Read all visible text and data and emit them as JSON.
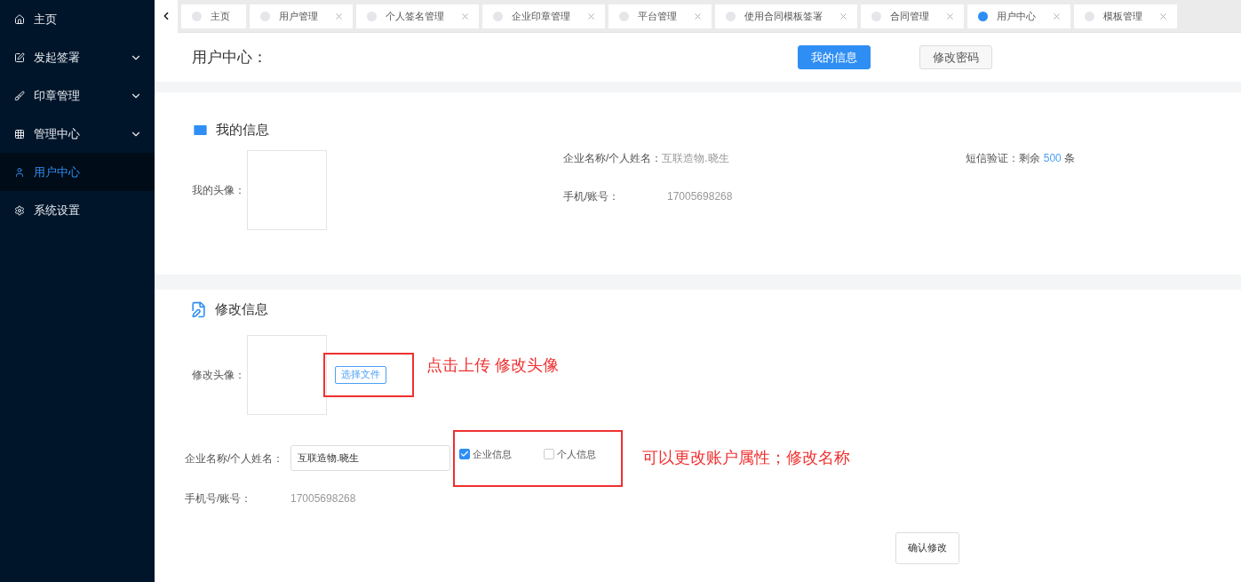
{
  "sidebar": {
    "items": [
      {
        "label": "主页",
        "expandable": false,
        "selected": false
      },
      {
        "label": "发起签署",
        "expandable": true,
        "selected": false
      },
      {
        "label": "印章管理",
        "expandable": true,
        "selected": false
      },
      {
        "label": "管理中心",
        "expandable": true,
        "selected": false
      },
      {
        "label": "用户中心",
        "expandable": false,
        "selected": true
      },
      {
        "label": "系统设置",
        "expandable": false,
        "selected": false
      }
    ]
  },
  "tabs": [
    {
      "label": "主页",
      "closable": false,
      "selected": false
    },
    {
      "label": "用户管理",
      "closable": true,
      "selected": false
    },
    {
      "label": "个人签名管理",
      "closable": true,
      "selected": false
    },
    {
      "label": "企业印章管理",
      "closable": true,
      "selected": false
    },
    {
      "label": "平台管理",
      "closable": true,
      "selected": false
    },
    {
      "label": "使用合同模板签署",
      "closable": true,
      "selected": false
    },
    {
      "label": "合同管理",
      "closable": true,
      "selected": false
    },
    {
      "label": "用户中心",
      "closable": true,
      "selected": true
    },
    {
      "label": "模板管理",
      "closable": true,
      "selected": false
    }
  ],
  "header": {
    "title": "用户中心：",
    "buttons": [
      {
        "label": "我的信息",
        "selected": true
      },
      {
        "label": "修改密码",
        "selected": false
      }
    ]
  },
  "my_info": {
    "title": "我的信息",
    "avatar_label": "我的头像：",
    "name_label": "企业名称/个人姓名：",
    "name_value": "互联造物.晓生",
    "phone_label": "手机/账号：",
    "phone_value": "17005698268",
    "sms_label": "短信验证：剩余",
    "sms_count": "500",
    "sms_unit": "条"
  },
  "edit_info": {
    "title": "修改信息",
    "avatar_label": "修改头像：",
    "file_button": "选择文件",
    "name_label": "企业名称/个人姓名：",
    "name_value": "互联造物.晓生",
    "account_types": [
      {
        "label": "企业信息",
        "checked": true
      },
      {
        "label": "个人信息",
        "checked": false
      }
    ],
    "phone_label": "手机号/账号：",
    "phone_value": "17005698268",
    "confirm_button": "确认修改"
  },
  "annotations": [
    "点击上传 修改头像",
    "可以更改账户属性；修改名称"
  ]
}
